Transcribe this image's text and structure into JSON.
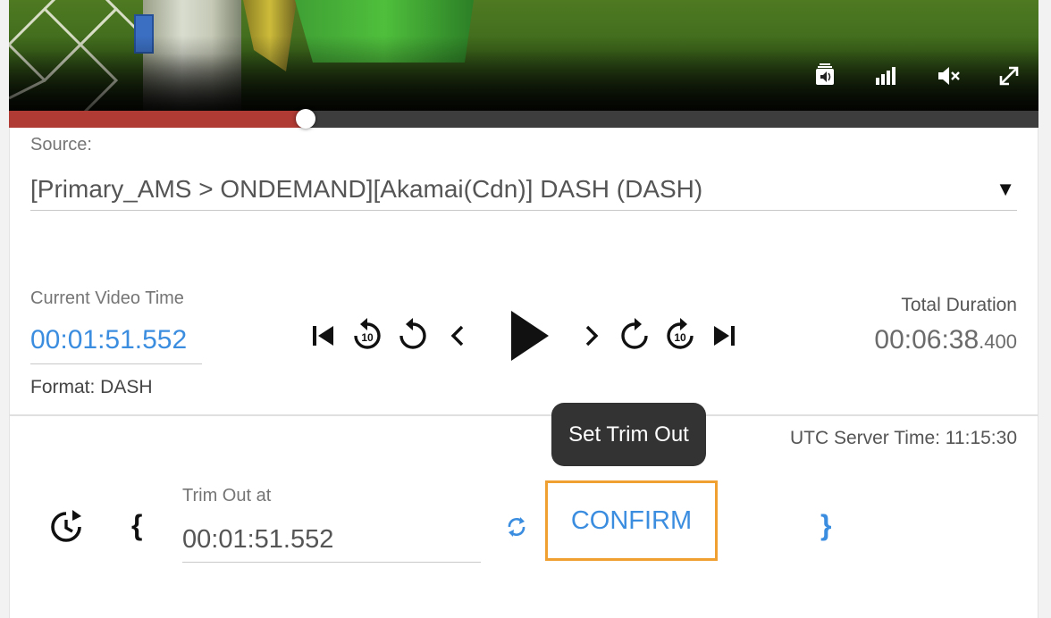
{
  "player": {
    "progress_fraction": 0.288,
    "icons": [
      "audio-track-icon",
      "quality-bars-icon",
      "mute-icon",
      "fullscreen-icon"
    ]
  },
  "source": {
    "label": "Source:",
    "value": "[Primary_AMS > ONDEMAND][Akamai(Cdn)] DASH (DASH)",
    "dropdown_icon": "▼"
  },
  "current_time": {
    "label": "Current Video Time",
    "value": "00:01:51.552"
  },
  "format": {
    "text": "Format: DASH"
  },
  "playback_controls": [
    "skip-to-start-icon",
    "rewind-10-icon",
    "replay-icon",
    "step-back-icon",
    "play-icon",
    "step-forward-icon",
    "forward-icon",
    "forward-10-icon",
    "skip-to-end-icon"
  ],
  "total_duration": {
    "label": "Total Duration",
    "main": "00:06:38",
    "ms": ".400"
  },
  "tooltip": {
    "text": "Set Trim Out"
  },
  "utc": {
    "text": "UTC Server Time: 11:15:30"
  },
  "trim": {
    "label": "Trim Out at",
    "value": "00:01:51.552",
    "open_brace": "{",
    "close_brace": "}",
    "confirm_label": "CONFIRM",
    "rewind_10": "10",
    "forward_10": "10"
  },
  "colors": {
    "accent": "#3b8de0",
    "progress": "#b03a34",
    "highlight": "#f0a030",
    "tooltip_bg": "#333333"
  }
}
